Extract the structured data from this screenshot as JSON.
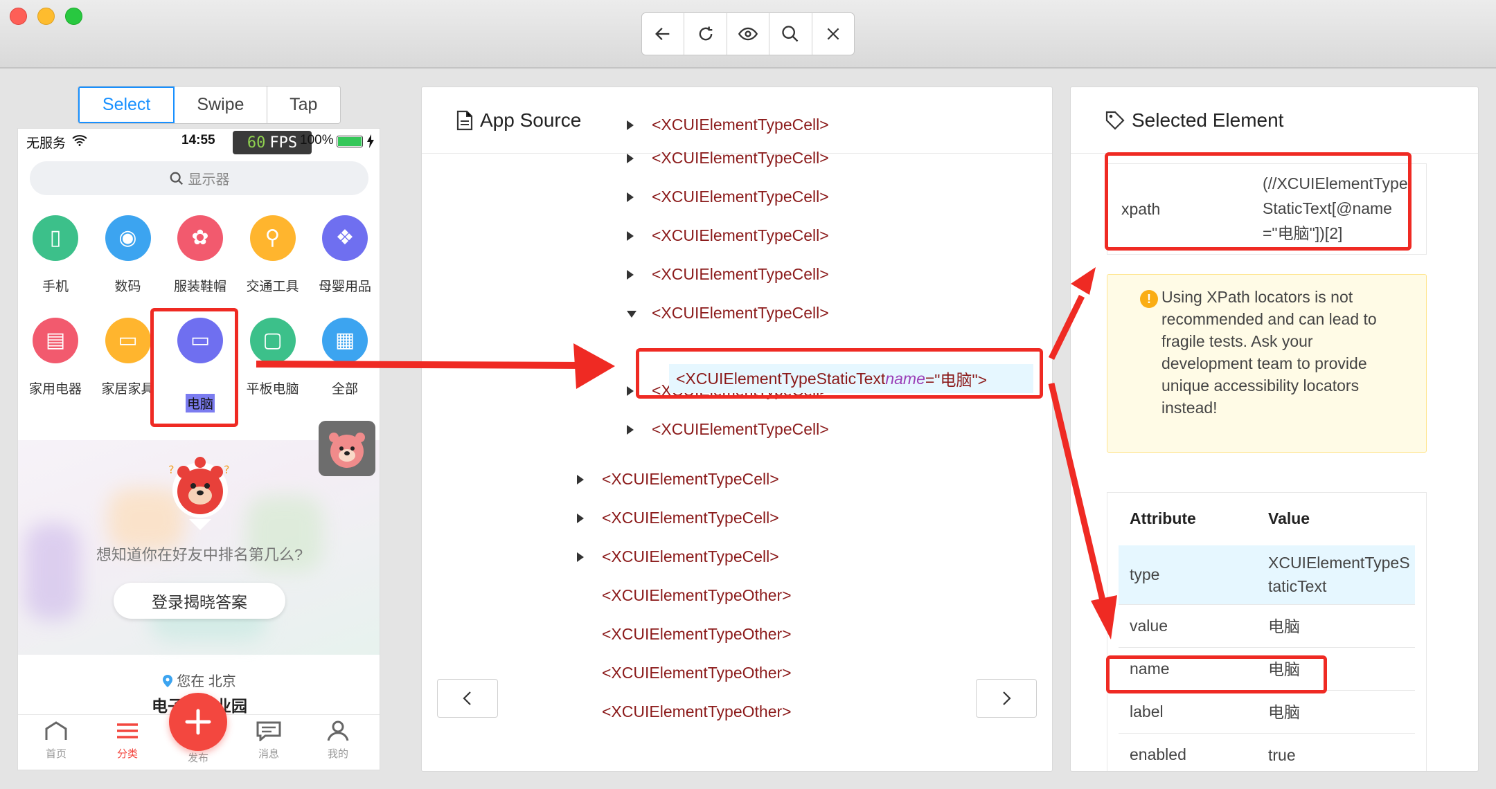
{
  "toolbar": {
    "buttons": [
      "back-icon",
      "refresh-icon",
      "eye-icon",
      "search-icon",
      "close-icon"
    ]
  },
  "modes": {
    "select": "Select",
    "swipe": "Swipe",
    "tap": "Tap"
  },
  "phone": {
    "status": {
      "carrier": "无服务",
      "time": "14:55",
      "fps_value": "60",
      "fps_label": "FPS",
      "battery": "100%"
    },
    "search_placeholder": "显示器",
    "categories": [
      {
        "label": "手机",
        "color": "#3cc08a"
      },
      {
        "label": "数码",
        "color": "#3ca4f0"
      },
      {
        "label": "服装鞋帽",
        "color": "#f25a6e"
      },
      {
        "label": "交通工具",
        "color": "#ffb52e"
      },
      {
        "label": "母婴用品",
        "color": "#6f6ff0"
      },
      {
        "label": "家用电器",
        "color": "#f25a6e"
      },
      {
        "label": "家居家具",
        "color": "#ffb52e"
      },
      {
        "label": "电脑",
        "color": "#6f6ff0"
      },
      {
        "label": "平板电脑",
        "color": "#3cc08a"
      },
      {
        "label": "全部",
        "color": "#3ca4f0"
      }
    ],
    "banner": {
      "text": "想知道你在好友中排名第几么?",
      "button": "登录揭晓答案"
    },
    "location": {
      "line1": "您在 北京",
      "line2": "电子城…业园"
    },
    "tabs": [
      {
        "label": "首页"
      },
      {
        "label": "分类"
      },
      {
        "label": "发布"
      },
      {
        "label": "消息"
      },
      {
        "label": "我的"
      }
    ]
  },
  "source": {
    "title": "App Source",
    "rows": [
      {
        "text": "<XCUIElementTypeCell>",
        "caret": "right"
      },
      {
        "text": "<XCUIElementTypeCell>",
        "caret": "right"
      },
      {
        "text": "<XCUIElementTypeCell>",
        "caret": "right"
      },
      {
        "text": "<XCUIElementTypeCell>",
        "caret": "right"
      },
      {
        "text": "<XCUIElementTypeCell>",
        "caret": "right"
      },
      {
        "text": "<XCUIElementTypeCell>",
        "caret": "down"
      },
      {
        "text": "<XCUIElementTypeCell>",
        "caret": "right"
      },
      {
        "text": "<XCUIElementTypeCell>",
        "caret": "right"
      },
      {
        "text": "<XCUIElementTypeCell>",
        "caret": "right"
      },
      {
        "text": "<XCUIElementTypeCell>",
        "caret": "right"
      },
      {
        "text": "<XCUIElementTypeCell>",
        "caret": "right"
      },
      {
        "text": "<XCUIElementTypeOther>",
        "caret": "none"
      },
      {
        "text": "<XCUIElementTypeOther>",
        "caret": "none"
      },
      {
        "text": "<XCUIElementTypeOther>",
        "caret": "none"
      },
      {
        "text": "<XCUIElementTypeOther>",
        "caret": "none"
      }
    ],
    "selected": {
      "open": "<XCUIElementTypeStaticText ",
      "attr_name": "name",
      "attr_value": "=\"电脑\">"
    }
  },
  "selected_element": {
    "title": "Selected Element",
    "xpath_label": "xpath",
    "xpath_value": "(//XCUIElementTypeStaticText[@name=\"电脑\"])[2]",
    "warning": "Using XPath locators is not recommended and can lead to fragile tests. Ask your development team to provide unique accessibility locators instead!",
    "table_headers": {
      "attribute": "Attribute",
      "value": "Value"
    },
    "attributes": [
      {
        "key": "type",
        "value": "XCUIElementTypeStaticText"
      },
      {
        "key": "value",
        "value": "电脑"
      },
      {
        "key": "name",
        "value": "电脑"
      },
      {
        "key": "label",
        "value": "电脑"
      },
      {
        "key": "enabled",
        "value": "true"
      }
    ]
  },
  "colors": {
    "accent": "#1890ff",
    "annotation_red": "#ef2a23",
    "tag_red": "#8b1a1a",
    "fab": "#f3473f"
  }
}
